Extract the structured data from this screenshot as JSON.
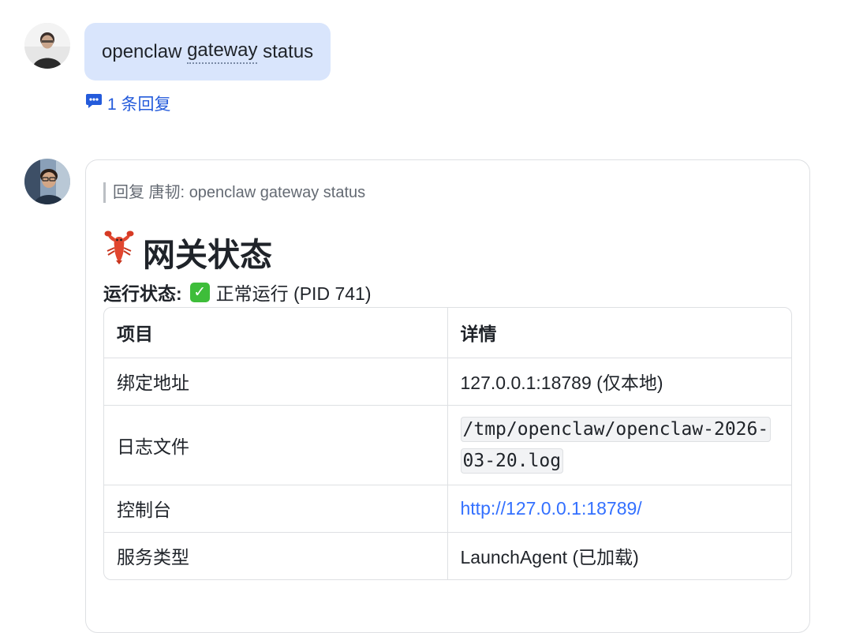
{
  "messages": [
    {
      "text_prefix": "openclaw ",
      "text_underlined": "gateway",
      "text_suffix": " status",
      "reply_count_label": "1 条回复"
    },
    {
      "quote_label": "回复 唐韧:",
      "quote_text": "openclaw gateway status",
      "heading_emoji": "lobster-icon",
      "heading": "网关状态",
      "status_label": "运行状态:",
      "status_value": "正常运行 (PID 741)",
      "table": {
        "headers": [
          "项目",
          "详情"
        ],
        "rows": [
          [
            "绑定地址",
            "127.0.0.1:18789 (仅本地)"
          ],
          [
            "日志文件",
            "/tmp/openclaw/openclaw-2026-03-20.log"
          ],
          [
            "控制台",
            "http://127.0.0.1:18789/"
          ],
          [
            "服务类型",
            "LaunchAgent (已加载)"
          ]
        ]
      }
    }
  ],
  "colors": {
    "bubble": "#d9e5fc",
    "link": "#3370ff",
    "reply_link": "#245bdb",
    "check": "#3ebd3a"
  }
}
